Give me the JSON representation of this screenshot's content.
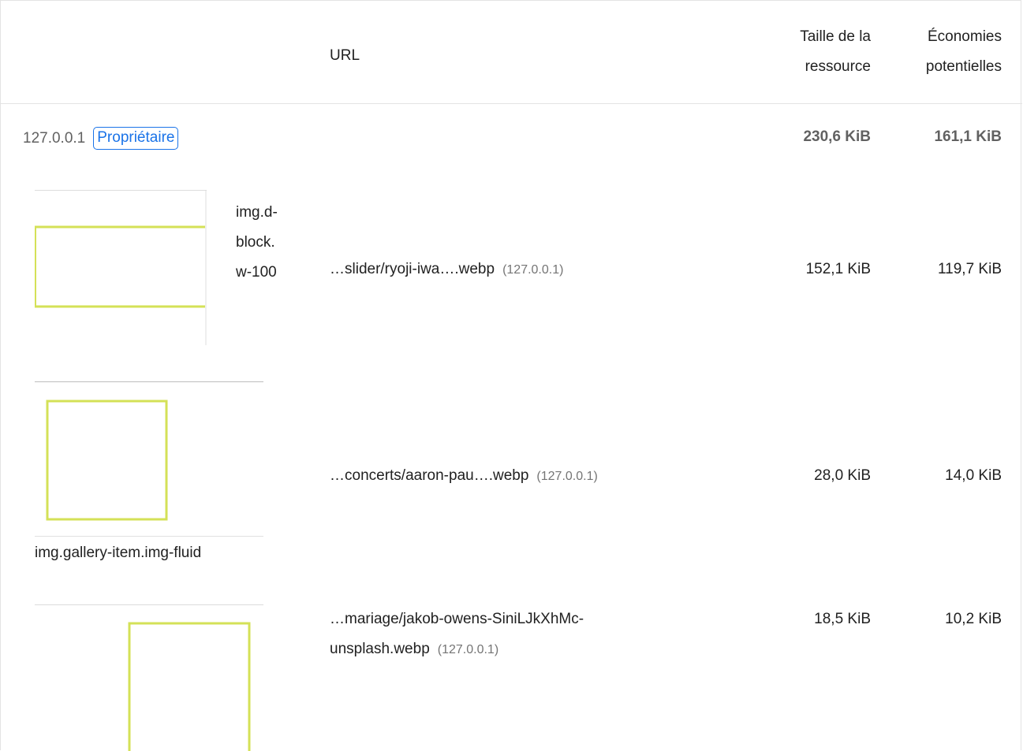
{
  "table": {
    "headers": {
      "url": "URL",
      "size_line1": "Taille de la",
      "size_line2": "ressource",
      "save_line1": "Économies",
      "save_line2": "potentielles"
    },
    "group": {
      "host": "127.0.0.1",
      "badge": "Propriétaire",
      "total_size": "230,6 KiB",
      "total_savings": "161,1 KiB"
    },
    "items": [
      {
        "selector_lines": [
          "img.d-",
          "block.",
          "w-100"
        ],
        "url": "…slider/ryoji-iwa….webp",
        "host": "(127.0.0.1)",
        "size": "152,1 KiB",
        "savings": "119,7 KiB"
      },
      {
        "selector": "img.gallery-item.img-fluid",
        "url": "…concerts/aaron-pau….webp",
        "host": "(127.0.0.1)",
        "size": "28,0 KiB",
        "savings": "14,0 KiB"
      },
      {
        "url_line1": "…mariage/jakob-owens-SiniLJkXhMc-",
        "url_line2": "unsplash.webp",
        "host": "(127.0.0.1)",
        "size": "18,5 KiB",
        "savings": "10,2 KiB"
      }
    ]
  },
  "colors": {
    "accent": "#1a73e8",
    "thumb_outline": "#d4e157",
    "border": "#e3e3e3",
    "muted_text": "#757575"
  }
}
